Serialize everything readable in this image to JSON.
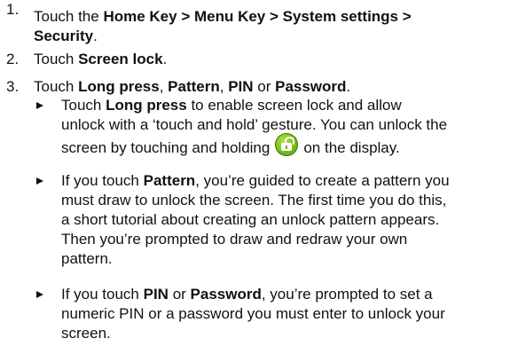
{
  "steps": [
    {
      "num": "1.",
      "pre": "Touch the ",
      "bold1": "Home Key > Menu Key > System settings >",
      "bold2": "Security",
      "post": "."
    },
    {
      "num": "2.",
      "pre": "Touch ",
      "bold": "Screen lock",
      "post": "."
    },
    {
      "num": "3.",
      "pre": "Touch ",
      "bold1": "Long press",
      "sep1": ", ",
      "bold2": "Pattern",
      "sep2": ", ",
      "bold3": "PIN",
      "sep3": " or ",
      "bold4": "Password",
      "post": "."
    }
  ],
  "bullets": [
    {
      "pre": "Touch ",
      "bold": "Long press",
      "line1_rest": " to enable screen lock and allow",
      "line2": "unlock with a ‘touch and hold’ gesture. You can unlock the",
      "line3_pre": "screen by touching and holding",
      "line3_post": "on the display.",
      "icon": "green-unlock-icon"
    },
    {
      "pre": "If you touch ",
      "bold": "Pattern",
      "line1_rest": ", you’re guided to create a pattern you",
      "line2": "must draw to unlock the screen. The first time you do this,",
      "line3": "a short tutorial about creating an unlock pattern appears.",
      "line4": "Then you’re prompted to draw and redraw your own",
      "line5": "pattern."
    },
    {
      "pre": "If you touch ",
      "bold1": "PIN",
      "mid": " or ",
      "bold2": "Password",
      "line1_rest": ", you’re prompted to set a",
      "line2": "numeric PIN or a password you must enter to unlock your",
      "line3": "screen."
    }
  ],
  "colors": {
    "text": "#111111",
    "icon_green": "#7cc21c"
  }
}
